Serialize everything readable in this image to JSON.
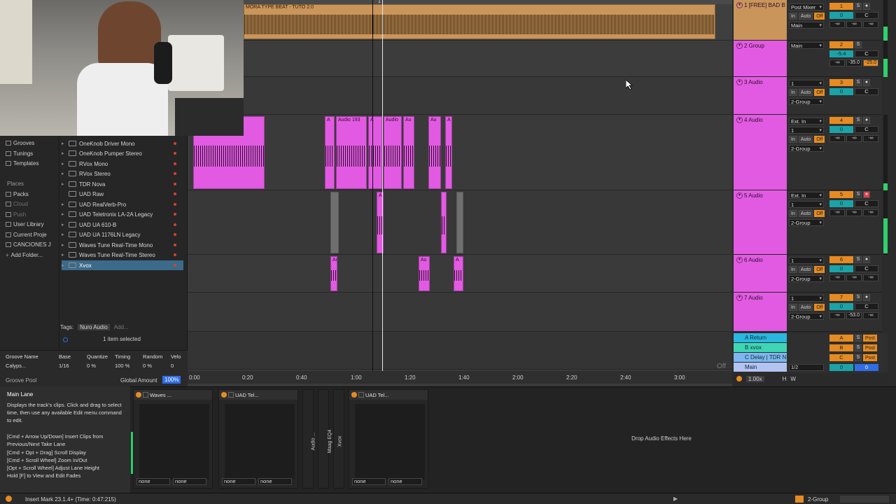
{
  "arrangement": {
    "top_clip_title": "MORA TYPE BEAT - TUTO 2.0",
    "loop_marker": "1",
    "ruler": [
      "0:00",
      "0:20",
      "0:40",
      "1:00",
      "1:20",
      "1:40",
      "2:00",
      "2:20",
      "2:40",
      "3:00"
    ],
    "clip_labels": [
      "A",
      "Audio 193",
      "A",
      "Au",
      "Audio",
      "A",
      "Au",
      "A",
      "A",
      "Au",
      "Au",
      "Au",
      "A"
    ],
    "off_label": "Off"
  },
  "browser": {
    "categories": [
      "Grooves",
      "Tunings",
      "Templates"
    ],
    "places_heading": "Places",
    "places": [
      "Packs",
      "Cloud",
      "Push",
      "User Library",
      "Current Proje",
      "CANCIONES J",
      "Add Folder..."
    ],
    "items": [
      "OneKnob Driver Mono",
      "OneKnob Pumper Stereo",
      "RVox Mono",
      "RVox Stereo",
      "TDR Nova",
      "UAD Raw",
      "UAD RealVerb-Pro",
      "UAD Teletronix LA-2A Legacy",
      "UAD UA 610-B",
      "UAD UA 1176LN Legacy",
      "Waves Tune Real-Time Mono",
      "Waves Tune Real-Time Stereo",
      "Xvox"
    ],
    "tags_label": "Tags:",
    "tag_value": "Nuro Audio",
    "tag_add": "Add...",
    "selection_status": "1 item selected"
  },
  "groove": {
    "headers": [
      "Groove Name",
      "Base",
      "Quantize",
      "Timing",
      "Random",
      "Velo"
    ],
    "row": [
      "Calyps...",
      "1/16",
      "0 %",
      "100 %",
      "0 %",
      "0"
    ],
    "pool_label": "Groove Pool",
    "global_amount_label": "Global Amount",
    "global_amount_value": "100%"
  },
  "tracks": [
    {
      "name": "1 [FREE] BAD B",
      "input": "Post Mixer",
      "output": "Main",
      "num": "1",
      "vol": "0",
      "pan": "C",
      "sends": [
        "-∞",
        "-∞",
        "-∞"
      ]
    },
    {
      "name": "2 Group",
      "input": "",
      "output": "Main",
      "num": "2",
      "vol": "-5.4",
      "pan": "C",
      "sends": [
        "-∞",
        "-35.0",
        "-25.0"
      ]
    },
    {
      "name": "3 Audio",
      "input": "1",
      "output": "2-Group",
      "num": "3",
      "vol": "0",
      "pan": "C",
      "sends": [
        "-∞",
        "-∞",
        "-∞"
      ]
    },
    {
      "name": "4 Audio",
      "input": "Ext. In",
      "input2": "1",
      "output": "2-Group",
      "num": "4",
      "vol": "0",
      "pan": "C",
      "sends": [
        "-∞",
        "-∞",
        "-∞"
      ]
    },
    {
      "name": "5 Audio",
      "input": "Ext. In",
      "input2": "1",
      "output": "2-Group",
      "num": "5",
      "vol": "0",
      "pan": "C",
      "sends": [
        "-∞",
        "-∞",
        "-∞"
      ]
    },
    {
      "name": "6 Audio",
      "input": "1",
      "output": "2-Group",
      "num": "6",
      "vol": "0",
      "pan": "C",
      "sends": [
        "-∞",
        "-∞",
        "-∞"
      ]
    },
    {
      "name": "7 Audio",
      "input": "1",
      "output": "2-Group",
      "num": "7",
      "vol": "0",
      "pan": "C",
      "sends": [
        "-∞",
        "-53.0",
        "-∞"
      ]
    }
  ],
  "monitor": {
    "in": "In",
    "auto": "Auto",
    "off": "Off"
  },
  "returns": [
    {
      "name": "A Return",
      "letter": "A",
      "color": "#2bb8e0"
    },
    {
      "name": "B xvox",
      "letter": "B",
      "color": "#3fd6b6"
    },
    {
      "name": "C Delay | TDR N",
      "letter": "C",
      "color": "#7db7ef"
    }
  ],
  "main": {
    "name": "Main",
    "cue": "1/2",
    "vol": "0",
    "pan": "0",
    "zoom": "1.00x",
    "h": "H",
    "w": "W",
    "post": "Post",
    "s": "S"
  },
  "info": {
    "title": "Main Lane",
    "body": "Displays the track's clips. Click and drag to select time, then use any available Edit menu command to edit.",
    "shortcuts": [
      "[Cmd + Arrow Up/Down] Insert Clips from Previous/Next Take Lane",
      "[Cmd + Opt + Drag] Scroll Display",
      "[Cmd + Scroll Wheel] Zoom In/Out",
      "[Opt + Scroll Wheel] Adjust Lane Height",
      "Hold [F] to View and Edit Fades"
    ]
  },
  "devices": [
    {
      "name": "Waves ...",
      "sel1": "none",
      "sel2": "none"
    },
    {
      "name": "UAD Tel...",
      "sel1": "none",
      "sel2": "none"
    },
    {
      "name": "UAD Tel...",
      "sel1": "none",
      "sel2": "none"
    }
  ],
  "mini_devices": [
    "Audio ...",
    "Maag EQ4",
    "Xvox"
  ],
  "drop_text": "Drop Audio Effects Here",
  "status": {
    "text": "Insert Mark 23.1.4+ (Time: 0:47:215)",
    "track": "2-Group"
  }
}
